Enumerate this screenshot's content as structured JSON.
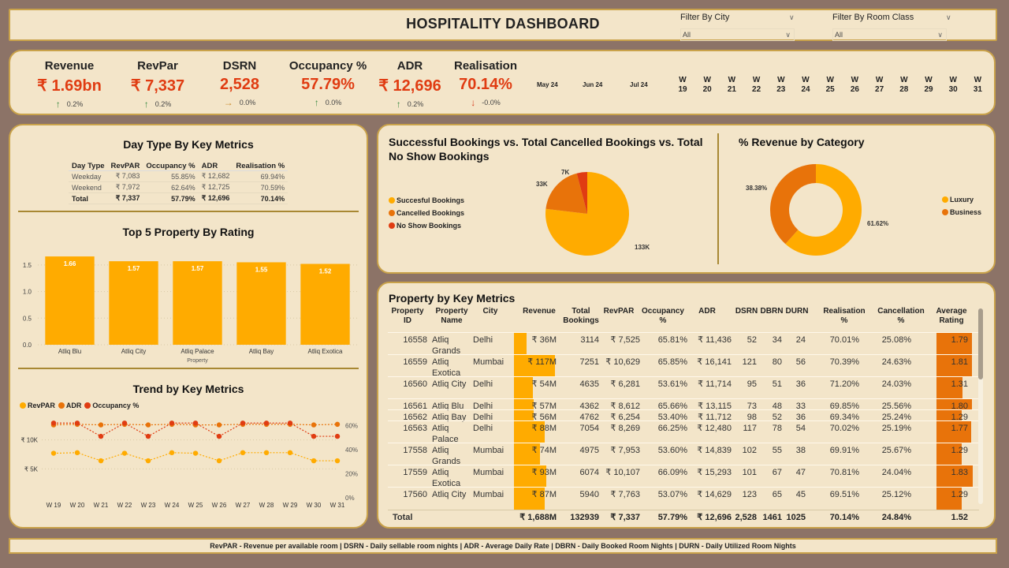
{
  "header": {
    "title": "HOSPITALITY DASHBOARD",
    "filters": [
      {
        "label": "Filter By City",
        "value": "All"
      },
      {
        "label": "Filter By Room Class",
        "value": "All"
      }
    ]
  },
  "kpis": [
    {
      "label": "Revenue",
      "value": "₹ 1.69bn",
      "delta": "0.2%",
      "trend": "up"
    },
    {
      "label": "RevPar",
      "value": "₹ 7,337",
      "delta": "0.2%",
      "trend": "up"
    },
    {
      "label": "DSRN",
      "value": "2,528",
      "delta": "0.0%",
      "trend": "flat"
    },
    {
      "label": "Occupancy %",
      "value": "57.79%",
      "delta": "0.0%",
      "trend": "up"
    },
    {
      "label": "ADR",
      "value": "₹ 12,696",
      "delta": "0.2%",
      "trend": "up"
    },
    {
      "label": "Realisation",
      "value": "70.14%",
      "delta": "-0.0%",
      "trend": "down"
    }
  ],
  "months": [
    "May 24",
    "Jun 24",
    "Jul 24"
  ],
  "weeks": [
    "19",
    "20",
    "21",
    "22",
    "23",
    "24",
    "25",
    "26",
    "27",
    "28",
    "29",
    "30",
    "31"
  ],
  "week_prefix": "W",
  "day_type": {
    "title": "Day Type By Key Metrics",
    "columns": [
      "Day Type",
      "RevPAR",
      "Occupancy %",
      "ADR",
      "Realisation %"
    ],
    "rows": [
      [
        "Weekday",
        "₹ 7,083",
        "55.85%",
        "₹ 12,682",
        "69.94%"
      ],
      [
        "Weekend",
        "₹ 7,972",
        "62.64%",
        "₹ 12,725",
        "70.59%"
      ]
    ],
    "total": [
      "Total",
      "₹ 7,337",
      "57.79%",
      "₹ 12,696",
      "70.14%"
    ]
  },
  "chart_data": [
    {
      "type": "bar",
      "title": "Top 5 Property By Rating",
      "categories": [
        "Atliq Blu",
        "Atliq City",
        "Atliq Palace",
        "Atliq Bay",
        "Atliq Exotica"
      ],
      "values": [
        1.66,
        1.57,
        1.57,
        1.55,
        1.52
      ],
      "data_labels": [
        "1.66",
        "1.57",
        "1.57",
        "1.55",
        "1.52"
      ],
      "xlabel": "Property",
      "ylabel": "",
      "ylim": [
        0,
        1.75
      ],
      "yticks": [
        "0.0",
        "0.5",
        "1.0",
        "1.5"
      ],
      "color": "#ffab00"
    },
    {
      "type": "line",
      "title": "Trend by Key Metrics",
      "x": [
        "W 19",
        "W 20",
        "W 21",
        "W 22",
        "W 23",
        "W 24",
        "W 25",
        "W 26",
        "W 27",
        "W 28",
        "W 29",
        "W 30",
        "W 31"
      ],
      "series": [
        {
          "name": "RevPAR",
          "axis": "left",
          "color": "#ffab00",
          "values": [
            7700,
            7800,
            6400,
            7700,
            6400,
            7800,
            7700,
            6400,
            7800,
            7800,
            7800,
            6400,
            6400
          ]
        },
        {
          "name": "ADR",
          "axis": "left",
          "color": "#e8730a",
          "values": [
            12600,
            12700,
            12600,
            12700,
            12600,
            12700,
            12600,
            12600,
            12700,
            12700,
            12700,
            12600,
            12700
          ]
        },
        {
          "name": "Occupancy %",
          "axis": "right",
          "color": "#e03c12",
          "values": [
            62,
            62,
            51,
            62,
            51,
            62,
            62,
            51,
            62,
            62,
            62,
            51,
            51
          ]
        }
      ],
      "left_ticks": [
        "₹ 5K",
        "₹ 10K"
      ],
      "right_ticks": [
        "0%",
        "20%",
        "40%",
        "60%"
      ],
      "ylim_left": [
        0,
        15000
      ],
      "ylim_right": [
        0,
        72
      ],
      "legend": "top-left"
    },
    {
      "type": "pie",
      "title": "Successful Bookings vs. Total Cancelled Bookings vs. Total No Show Bookings",
      "categories": [
        "Succesful Bookings",
        "Cancelled Bookings",
        "No Show Bookings"
      ],
      "values": [
        133,
        33,
        7
      ],
      "data_labels": [
        "133K",
        "33K",
        "7K"
      ],
      "colors": [
        "#ffab00",
        "#e8730a",
        "#e03c12"
      ],
      "legend": "left"
    },
    {
      "type": "pie",
      "subtype": "donut",
      "title": "% Revenue by Category",
      "categories": [
        "Luxury",
        "Business"
      ],
      "values": [
        61.62,
        38.38
      ],
      "data_labels": [
        "61.62%",
        "38.38%"
      ],
      "colors": [
        "#ffab00",
        "#e8730a"
      ],
      "legend": "right"
    }
  ],
  "property_table": {
    "title": "Property by Key Metrics",
    "columns": [
      "Property ID",
      "Property Name",
      "City",
      "Revenue",
      "Total Bookings",
      "RevPAR",
      "Occupancy %",
      "ADR",
      "DSRN",
      "DBRN",
      "DURN",
      "Realisation %",
      "Cancellation %",
      "Average Rating"
    ],
    "rows": [
      {
        "id": "16558",
        "name": "Atliq Grands",
        "city": "Delhi",
        "revenue": "₹ 36M",
        "rev_m": 36,
        "bookings": "3114",
        "revpar": "₹ 7,525",
        "occ": "65.81%",
        "adr": "₹ 11,436",
        "dsrn": "52",
        "dbrn": "34",
        "durn": "24",
        "real": "70.01%",
        "canc": "25.08%",
        "rating": "1.79",
        "rating_v": 1.79
      },
      {
        "id": "16559",
        "name": "Atliq Exotica",
        "city": "Mumbai",
        "revenue": "₹ 117M",
        "rev_m": 117,
        "bookings": "7251",
        "revpar": "₹ 10,629",
        "occ": "65.85%",
        "adr": "₹ 16,141",
        "dsrn": "121",
        "dbrn": "80",
        "durn": "56",
        "real": "70.39%",
        "canc": "24.63%",
        "rating": "1.81",
        "rating_v": 1.81
      },
      {
        "id": "16560",
        "name": "Atliq City",
        "city": "Delhi",
        "revenue": "₹ 54M",
        "rev_m": 54,
        "bookings": "4635",
        "revpar": "₹ 6,281",
        "occ": "53.61%",
        "adr": "₹ 11,714",
        "dsrn": "95",
        "dbrn": "51",
        "durn": "36",
        "real": "71.20%",
        "canc": "24.03%",
        "rating": "1.31",
        "rating_v": 1.31
      },
      {
        "id": "16561",
        "name": "Atliq Blu",
        "city": "Delhi",
        "revenue": "₹ 57M",
        "rev_m": 57,
        "bookings": "4362",
        "revpar": "₹ 8,612",
        "occ": "65.66%",
        "adr": "₹ 13,115",
        "dsrn": "73",
        "dbrn": "48",
        "durn": "33",
        "real": "69.85%",
        "canc": "25.56%",
        "rating": "1.80",
        "rating_v": 1.8
      },
      {
        "id": "16562",
        "name": "Atliq Bay",
        "city": "Delhi",
        "revenue": "₹ 56M",
        "rev_m": 56,
        "bookings": "4762",
        "revpar": "₹ 6,254",
        "occ": "53.40%",
        "adr": "₹ 11,712",
        "dsrn": "98",
        "dbrn": "52",
        "durn": "36",
        "real": "69.34%",
        "canc": "25.24%",
        "rating": "1.29",
        "rating_v": 1.29
      },
      {
        "id": "16563",
        "name": "Atliq Palace",
        "city": "Delhi",
        "revenue": "₹ 88M",
        "rev_m": 88,
        "bookings": "7054",
        "revpar": "₹ 8,269",
        "occ": "66.25%",
        "adr": "₹ 12,480",
        "dsrn": "117",
        "dbrn": "78",
        "durn": "54",
        "real": "70.02%",
        "canc": "25.19%",
        "rating": "1.77",
        "rating_v": 1.77
      },
      {
        "id": "17558",
        "name": "Atliq Grands",
        "city": "Mumbai",
        "revenue": "₹ 74M",
        "rev_m": 74,
        "bookings": "4975",
        "revpar": "₹ 7,953",
        "occ": "53.60%",
        "adr": "₹ 14,839",
        "dsrn": "102",
        "dbrn": "55",
        "durn": "38",
        "real": "69.91%",
        "canc": "25.67%",
        "rating": "1.29",
        "rating_v": 1.29
      },
      {
        "id": "17559",
        "name": "Atliq Exotica",
        "city": "Mumbai",
        "revenue": "₹ 93M",
        "rev_m": 93,
        "bookings": "6074",
        "revpar": "₹ 10,107",
        "occ": "66.09%",
        "adr": "₹ 15,293",
        "dsrn": "101",
        "dbrn": "67",
        "durn": "47",
        "real": "70.81%",
        "canc": "24.04%",
        "rating": "1.83",
        "rating_v": 1.83
      },
      {
        "id": "17560",
        "name": "Atliq City",
        "city": "Mumbai",
        "revenue": "₹ 87M",
        "rev_m": 87,
        "bookings": "5940",
        "revpar": "₹ 7,763",
        "occ": "53.07%",
        "adr": "₹ 14,629",
        "dsrn": "123",
        "dbrn": "65",
        "durn": "45",
        "real": "69.51%",
        "canc": "25.12%",
        "rating": "1.29",
        "rating_v": 1.29
      }
    ],
    "total": {
      "label": "Total",
      "revenue": "₹ 1,688M",
      "bookings": "132939",
      "revpar": "₹ 7,337",
      "occ": "57.79%",
      "adr": "₹ 12,696",
      "dsrn": "2,528",
      "dbrn": "1461",
      "durn": "1025",
      "real": "70.14%",
      "canc": "24.84%",
      "rating": "1.52"
    }
  },
  "footer": "RevPAR - Revenue per available room | DSRN - Daily sellable room nights | ADR - Average Daily Rate | DBRN - Daily Booked Room Nights | DURN - Daily Utilized Room Nights"
}
